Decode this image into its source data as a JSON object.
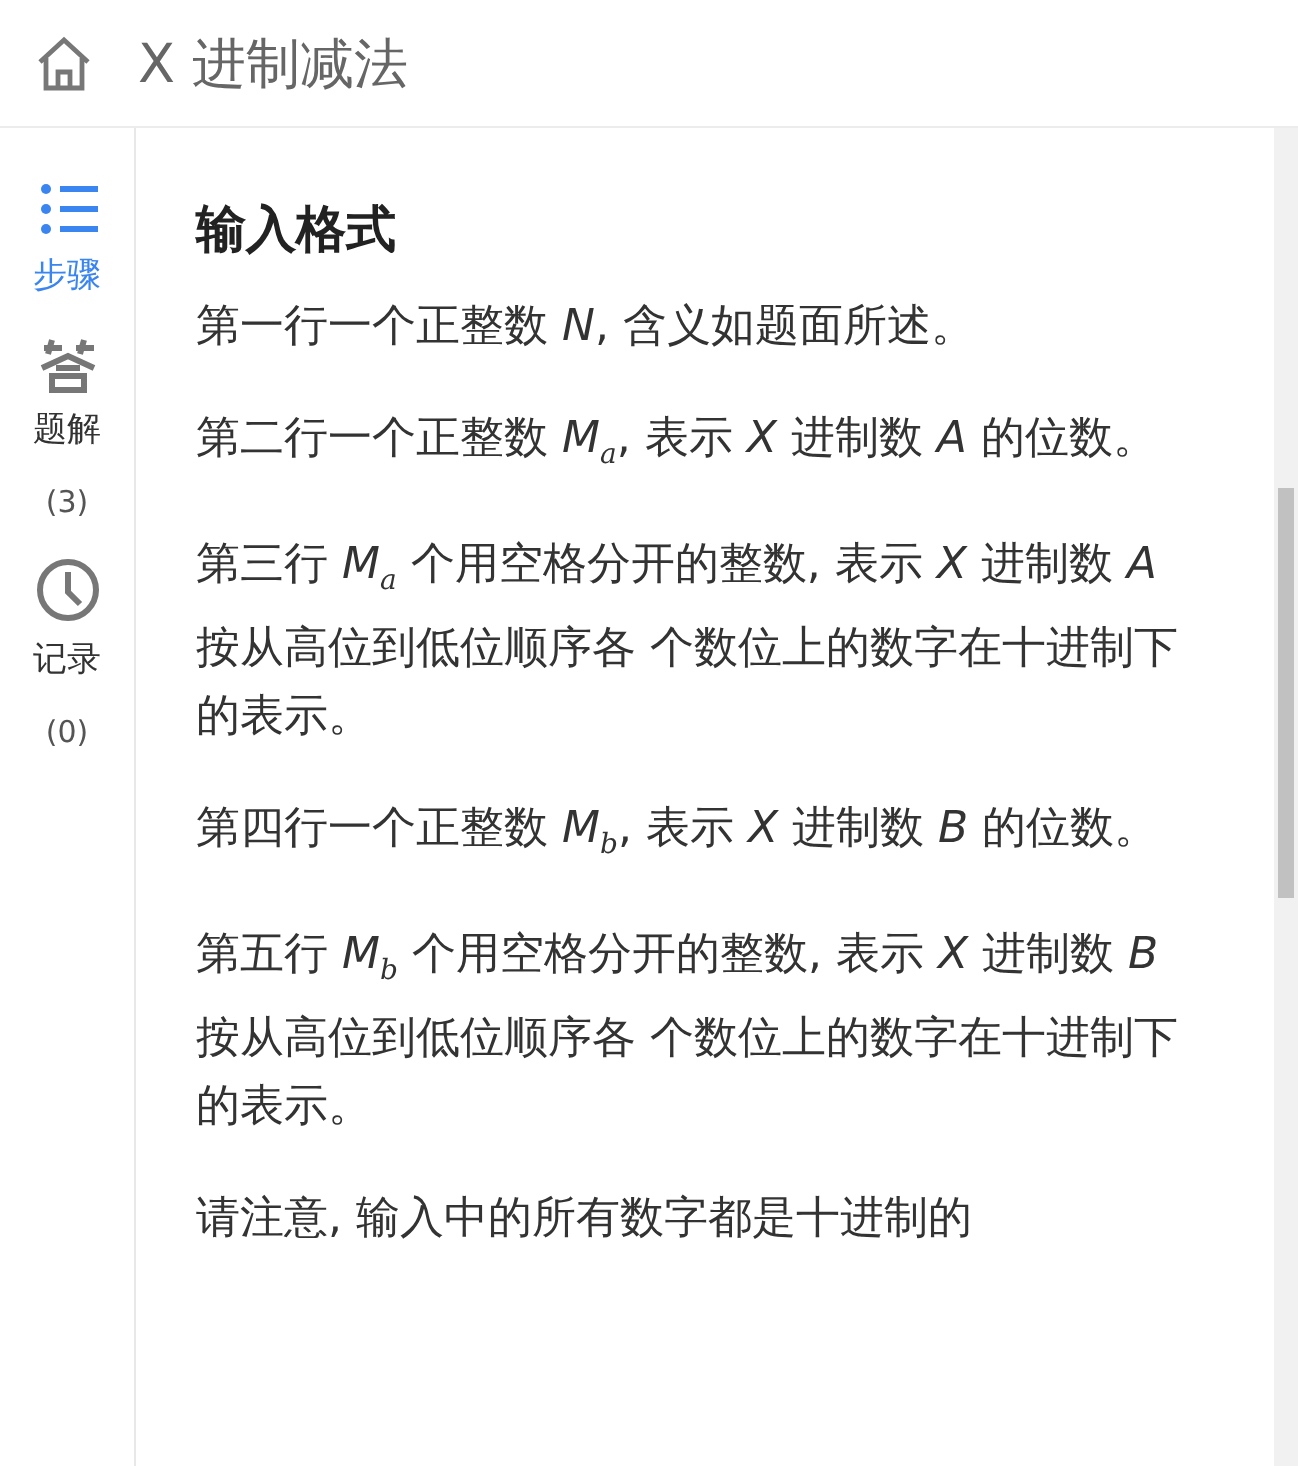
{
  "header": {
    "title": "X 进制减法"
  },
  "sidebar": {
    "items": [
      {
        "kind": "steps",
        "label": "步骤",
        "selected": true
      },
      {
        "kind": "answer",
        "label": "题解",
        "count": "(3)",
        "selected": false
      },
      {
        "kind": "history",
        "label": "记录",
        "count": "(0)",
        "selected": false
      }
    ]
  },
  "content": {
    "heading": "输入格式",
    "paragraphs": [
      "第一行一个正整数 *N*, 含义如题面所述。",
      "第二行一个正整数 *M*$_{a}$, 表示 *X* 进制数 *A* 的位数。",
      "第三行 *M*$_{a}$ 个用空格分开的整数, 表示 *X* 进制数 *A* 按从高位到低位顺序各 个数位上的数字在十进制下的表示。",
      "第四行一个正整数 *M*$_{b}$, 表示 *X* 进制数 *B* 的位数。",
      "第五行 *M*$_{b}$ 个用空格分开的整数, 表示 *X* 进制数 *B* 按从高位到低位顺序各 个数位上的数字在十进制下的表示。",
      "请注意, 输入中的所有数字都是十进制的"
    ]
  }
}
